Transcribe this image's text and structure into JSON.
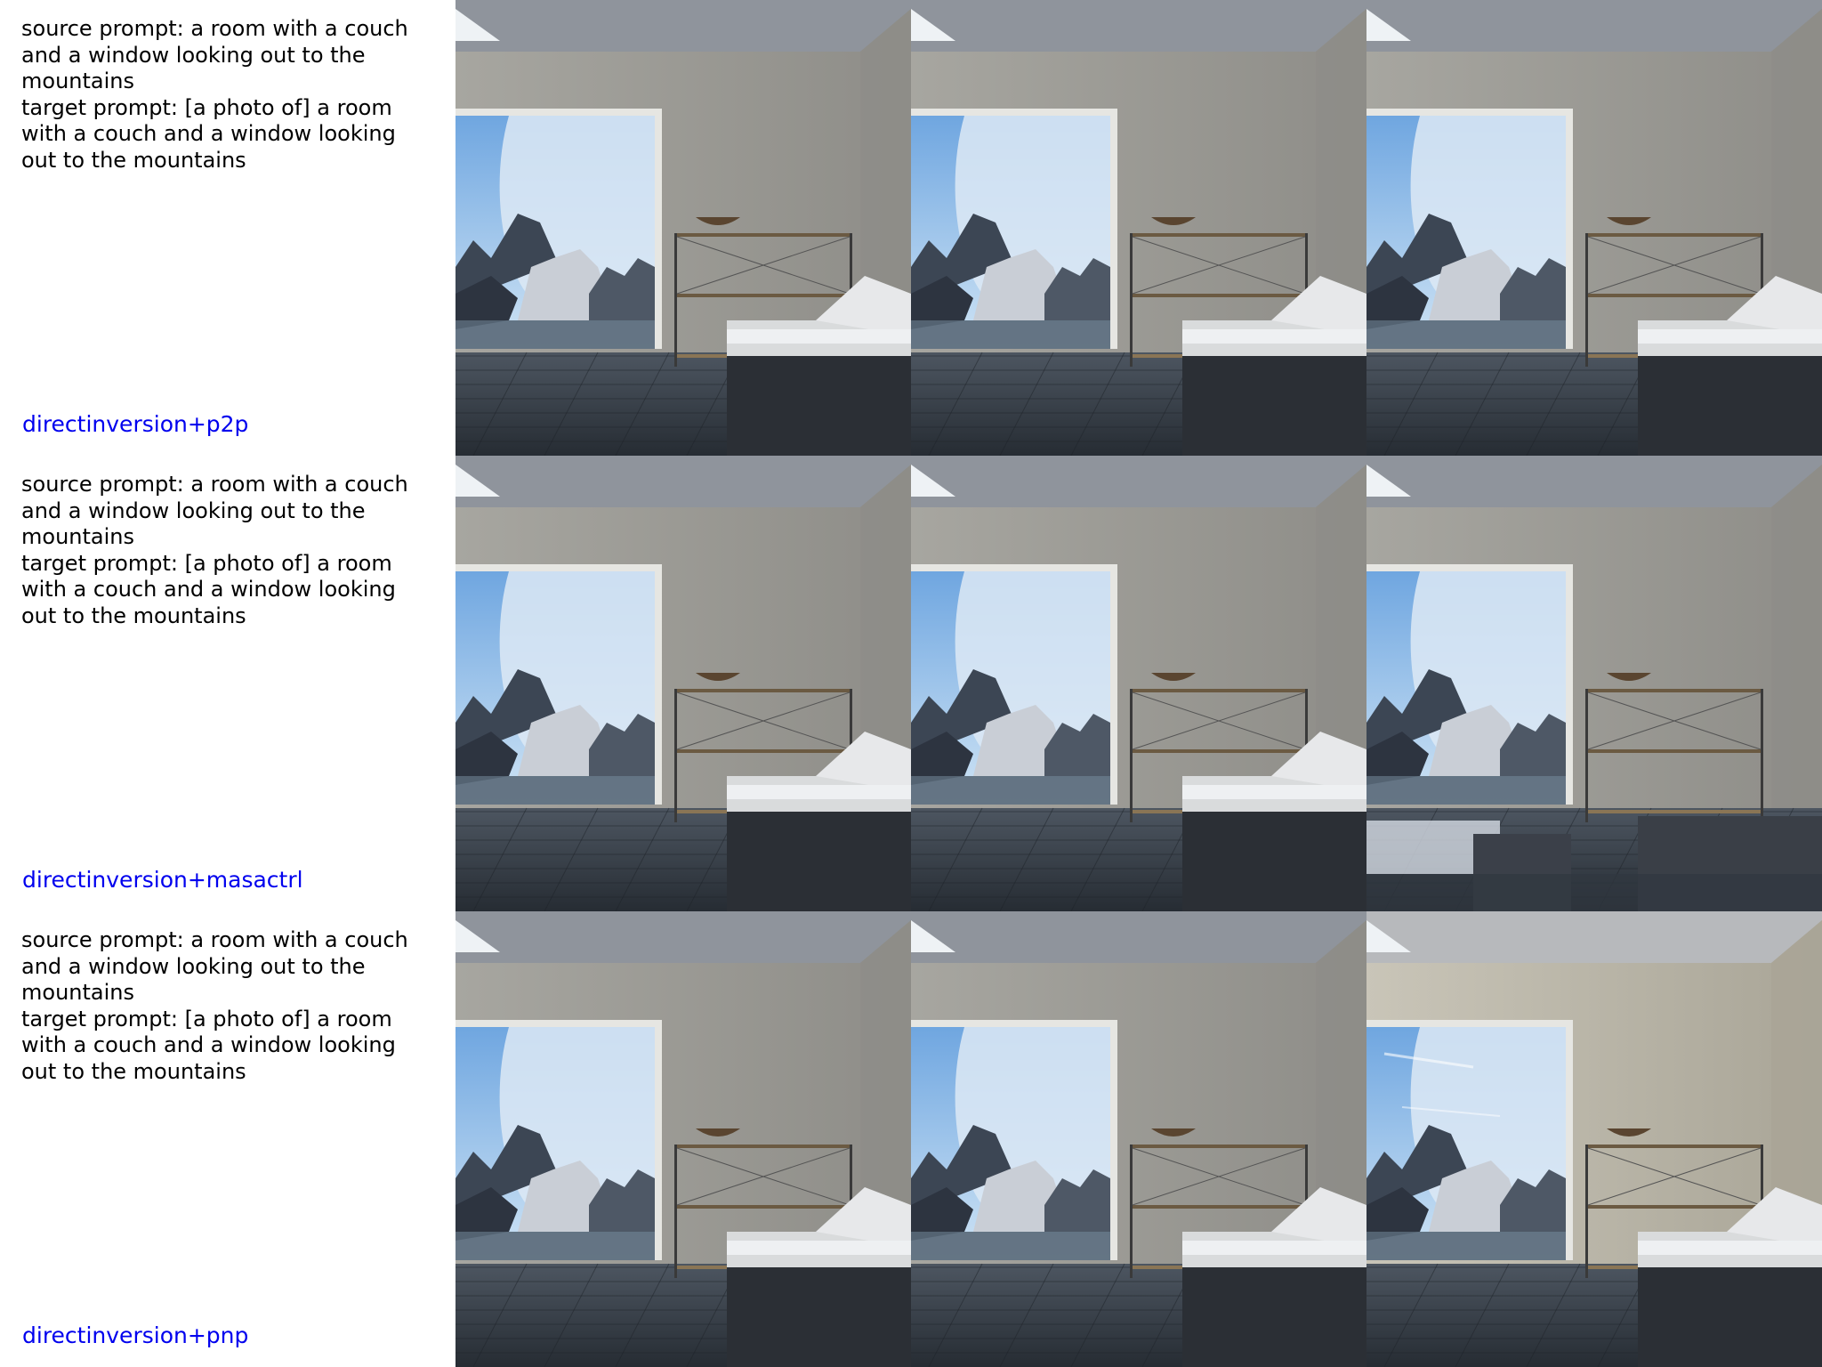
{
  "rows": [
    {
      "source_prompt": "source prompt: a room with a couch and a window looking out to the mountains",
      "target_prompt": "target prompt: [a photo of] a room with a couch and a window looking out to the mountains",
      "method": "directinversion+p2p",
      "tiles": [
        "room-view",
        "room-view",
        "room-view"
      ]
    },
    {
      "source_prompt": "source prompt: a room with a couch and a window looking out to the mountains",
      "target_prompt": "target prompt: [a photo of] a room with a couch and a window looking out to the mountains",
      "method": "directinversion+masactrl",
      "tiles": [
        "room-view",
        "room-view",
        "room-view-distorted"
      ]
    },
    {
      "source_prompt": "source prompt: a room with a couch and a window looking out to the mountains",
      "target_prompt": "target prompt: [a photo of] a room with a couch and a window looking out to the mountains",
      "method": "directinversion+pnp",
      "tiles": [
        "room-view",
        "room-view",
        "room-view-bright"
      ]
    }
  ],
  "colors": {
    "method_label": "#0000ee",
    "prompt_text": "#000000"
  }
}
